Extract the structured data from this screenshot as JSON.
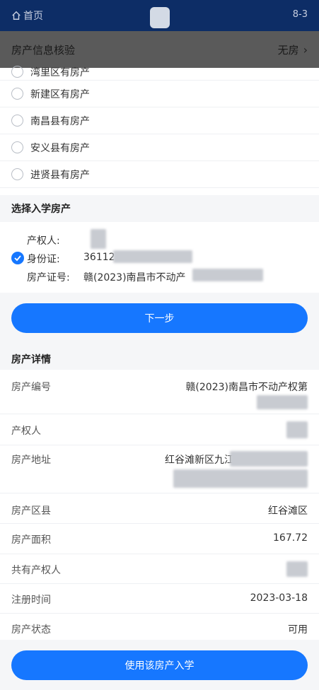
{
  "topbar": {
    "home_label": "首页",
    "version": "8-3"
  },
  "verify": {
    "label": "房产信息核验",
    "value": "无房",
    "chevron": "›"
  },
  "radio_options": [
    {
      "label": "湾里区有房产"
    },
    {
      "label": "新建区有房产"
    },
    {
      "label": "南昌县有房产"
    },
    {
      "label": "安义县有房产"
    },
    {
      "label": "进贤县有房产"
    }
  ],
  "select_section": {
    "title": "选择入学房产",
    "owner_label": "产权人:",
    "owner_value": "",
    "id_label": "身份证:",
    "id_value": "36112",
    "cert_label": "房产证号:",
    "cert_value": "赣(2023)南昌市不动产"
  },
  "next_button": "下一步",
  "details": {
    "title": "房产详情",
    "rows": [
      {
        "label": "房产编号",
        "value": "赣(2023)南昌市不动产权第"
      },
      {
        "label": "产权人",
        "value": ""
      },
      {
        "label": "房产地址",
        "value": "红谷滩新区九江"
      },
      {
        "label": "房产区县",
        "value": "红谷滩区"
      },
      {
        "label": "房产面积",
        "value": "167.72"
      },
      {
        "label": "共有产权人",
        "value": ""
      },
      {
        "label": "注册时间",
        "value": "2023-03-18"
      },
      {
        "label": "房产状态",
        "value": "可用"
      }
    ]
  },
  "use_button": "使用该房产入学",
  "colors": {
    "primary": "#1677ff",
    "topbar": "#0d2d66",
    "section_bg": "#f5f6f8"
  }
}
